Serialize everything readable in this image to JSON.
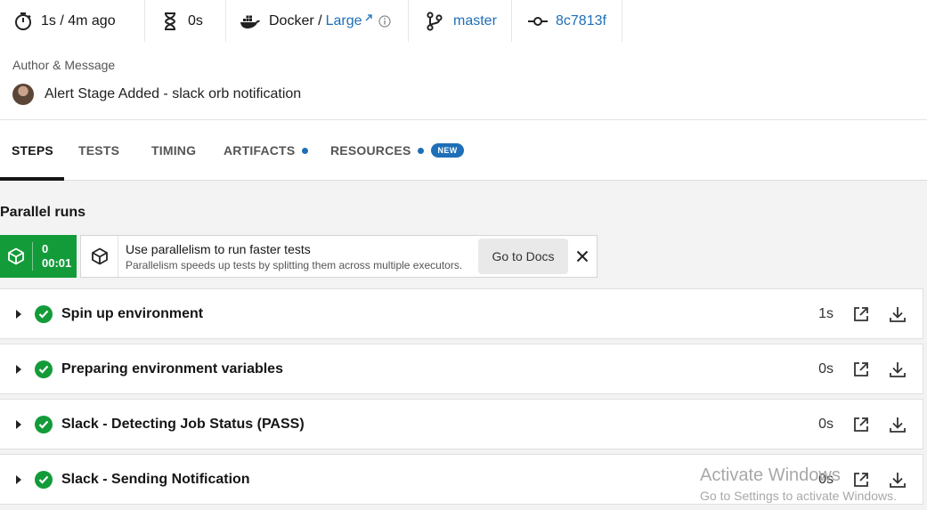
{
  "meta": {
    "duration": "1s / 4m ago",
    "queued": "0s",
    "executor_prefix": "Docker / ",
    "executor_link": "Large",
    "branch": "master",
    "commit": "8c7813f"
  },
  "author": {
    "label": "Author & Message",
    "message": "Alert Stage Added - slack orb notification"
  },
  "tabs": [
    {
      "label": "STEPS"
    },
    {
      "label": "TESTS"
    },
    {
      "label": "TIMING"
    },
    {
      "label": "ARTIFACTS"
    },
    {
      "label": "RESOURCES",
      "badge": "NEW"
    }
  ],
  "parallel": {
    "title": "Parallel runs",
    "run_index": "0",
    "run_time": "00:01",
    "tip_title": "Use parallelism to run faster tests",
    "tip_sub": "Parallelism speeds up tests by splitting them across multiple executors.",
    "docs_label": "Go to Docs"
  },
  "steps": [
    {
      "name": "Spin up environment",
      "duration": "1s"
    },
    {
      "name": "Preparing environment variables",
      "duration": "0s"
    },
    {
      "name": "Slack - Detecting Job Status (PASS)",
      "duration": "0s"
    },
    {
      "name": "Slack - Sending Notification",
      "duration": "0s"
    }
  ],
  "watermark": {
    "line1": "Activate Windows",
    "line2": "Go to Settings to activate Windows."
  },
  "colors": {
    "success": "#139b39",
    "accent": "#1e6fb8"
  }
}
